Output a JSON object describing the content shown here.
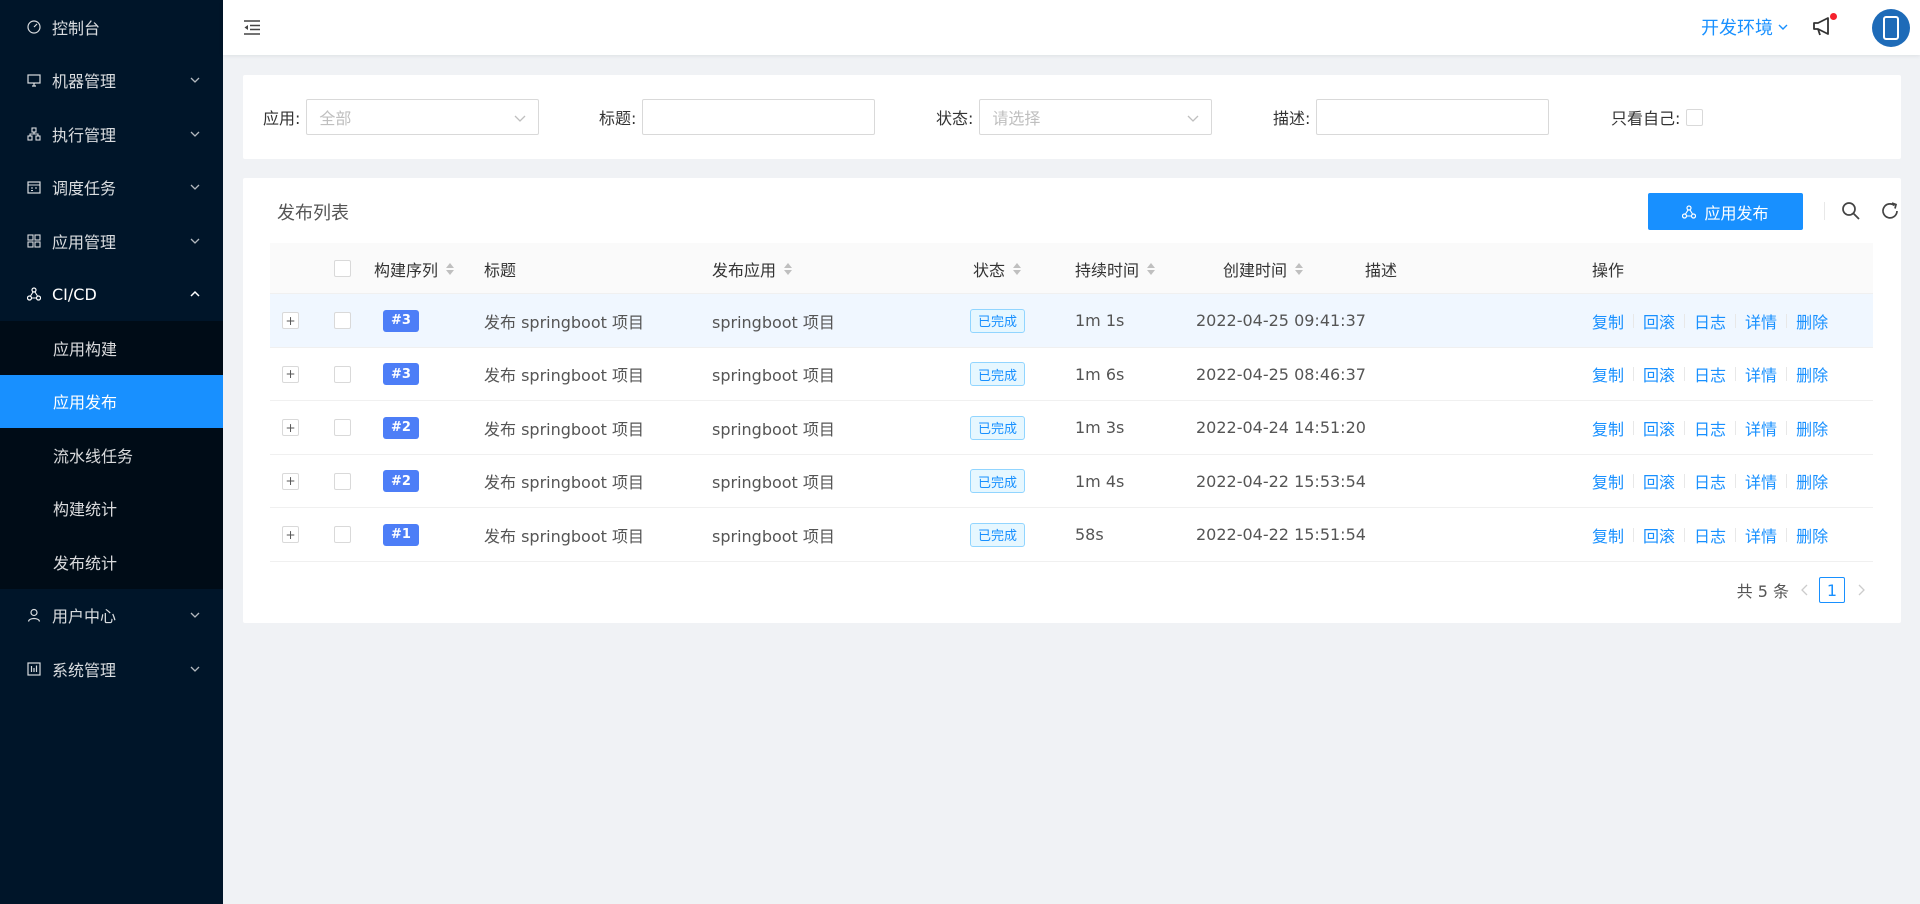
{
  "sidebar": {
    "items": [
      {
        "label": "控制台",
        "icon": "dashboard-icon"
      },
      {
        "label": "机器管理",
        "icon": "desktop-icon"
      },
      {
        "label": "执行管理",
        "icon": "cluster-icon"
      },
      {
        "label": "调度任务",
        "icon": "schedule-icon"
      },
      {
        "label": "应用管理",
        "icon": "appstore-icon"
      },
      {
        "label": "CI/CD",
        "icon": "deployment-icon"
      },
      {
        "label": "用户中心",
        "icon": "user-icon"
      },
      {
        "label": "系统管理",
        "icon": "settings-icon"
      }
    ],
    "cicd_sub": [
      {
        "label": "应用构建"
      },
      {
        "label": "应用发布"
      },
      {
        "label": "流水线任务"
      },
      {
        "label": "构建统计"
      },
      {
        "label": "发布统计"
      }
    ]
  },
  "header": {
    "env": "开发环境"
  },
  "filters": {
    "app_label": "应用:",
    "app_placeholder": "全部",
    "title_label": "标题:",
    "title_value": "",
    "status_label": "状态:",
    "status_placeholder": "请选择",
    "desc_label": "描述:",
    "desc_value": "",
    "self_label": "只看自己:"
  },
  "table_card": {
    "title": "发布列表",
    "publish_button": "应用发布",
    "columns": {
      "seq": "构建序列",
      "title": "标题",
      "app": "发布应用",
      "status": "状态",
      "duration": "持续时间",
      "created": "创建时间",
      "desc": "描述",
      "actions": "操作"
    },
    "action_labels": [
      "复制",
      "回滚",
      "日志",
      "详情",
      "删除"
    ],
    "rows": [
      {
        "seq": "#3",
        "title": "发布 springboot 项目",
        "app": "springboot 项目",
        "status": "已完成",
        "duration": "1m 1s",
        "created": "2022-04-25 09:41:37",
        "desc": ""
      },
      {
        "seq": "#3",
        "title": "发布 springboot 项目",
        "app": "springboot 项目",
        "status": "已完成",
        "duration": "1m 6s",
        "created": "2022-04-25 08:46:37",
        "desc": ""
      },
      {
        "seq": "#2",
        "title": "发布 springboot 项目",
        "app": "springboot 项目",
        "status": "已完成",
        "duration": "1m 3s",
        "created": "2022-04-24 14:51:20",
        "desc": ""
      },
      {
        "seq": "#2",
        "title": "发布 springboot 项目",
        "app": "springboot 项目",
        "status": "已完成",
        "duration": "1m 4s",
        "created": "2022-04-22 15:53:54",
        "desc": ""
      },
      {
        "seq": "#1",
        "title": "发布 springboot 项目",
        "app": "springboot 项目",
        "status": "已完成",
        "duration": "58s",
        "created": "2022-04-22 15:51:54",
        "desc": ""
      }
    ],
    "pagination": {
      "total_text": "共 5 条",
      "current_page": "1"
    }
  },
  "colors": {
    "accent": "#1890ff",
    "sidebar_bg": "#001529",
    "badge": "#4d7ef7"
  }
}
